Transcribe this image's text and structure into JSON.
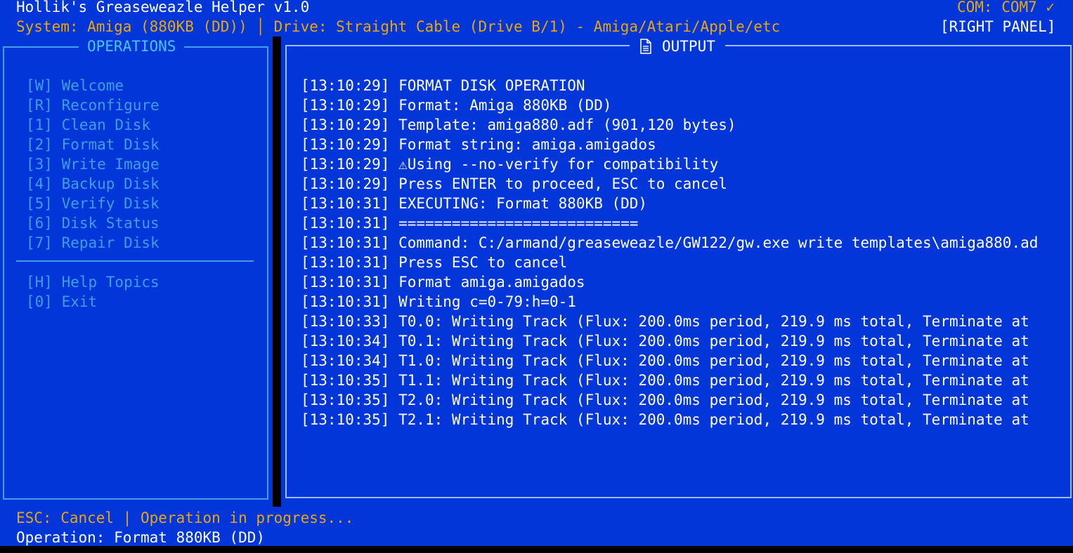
{
  "header": {
    "title": "Hollik's Greaseweazle Helper v1.0",
    "com_status": "COM: COM7 ✓",
    "system_drive": "System: Amiga (880KB (DD)) │ Drive: Straight Cable (Drive B/1) - Amiga/Atari/Apple/etc",
    "panel_indicator": "[RIGHT PANEL]"
  },
  "operations": {
    "title": "OPERATIONS",
    "items": [
      "[W] Welcome",
      "[R] Reconfigure",
      "[1] Clean Disk",
      "[2] Format Disk",
      "[3] Write Image",
      "[4] Backup Disk",
      "[5] Verify Disk",
      "[6] Disk Status",
      "[7] Repair Disk"
    ],
    "extra_items": [
      "[H] Help Topics",
      "[0] Exit"
    ]
  },
  "output": {
    "title": "OUTPUT",
    "icon": "document-icon",
    "lines": [
      "[13:10:29] FORMAT DISK OPERATION",
      "[13:10:29] Format: Amiga 880KB (DD)",
      "[13:10:29] Template: amiga880.adf (901,120 bytes)",
      "[13:10:29] Format string: amiga.amigados",
      "[13:10:29] ⚠Using --no-verify for compatibility",
      "[13:10:29] Press ENTER to proceed, ESC to cancel",
      "[13:10:31] EXECUTING: Format 880KB (DD)",
      "[13:10:31] ===========================",
      "[13:10:31] Command: C:/armand/greaseweazle/GW122/gw.exe write templates\\amiga880.ad",
      "[13:10:31] Press ESC to cancel",
      "[13:10:31] Format amiga.amigados",
      "[13:10:31] Writing c=0-79:h=0-1",
      "[13:10:33] T0.0: Writing Track (Flux: 200.0ms period, 219.9 ms total, Terminate at",
      "[13:10:34] T0.1: Writing Track (Flux: 200.0ms period, 219.9 ms total, Terminate at",
      "[13:10:34] T1.0: Writing Track (Flux: 200.0ms period, 219.9 ms total, Terminate at",
      "[13:10:35] T1.1: Writing Track (Flux: 200.0ms period, 219.9 ms total, Terminate at",
      "[13:10:35] T2.0: Writing Track (Flux: 200.0ms period, 219.9 ms total, Terminate at",
      "[13:10:35] T2.1: Writing Track (Flux: 200.0ms period, 219.9 ms total, Terminate at"
    ]
  },
  "footer": {
    "hint": "ESC: Cancel | Operation in progress...",
    "operation": "Operation: Format 880KB (DD)"
  },
  "colors": {
    "background": "#0236d8",
    "amber": "#e8a70c",
    "menu": "#3f9ee6",
    "title_cyan": "#4cc3f0",
    "text": "#ffffff"
  }
}
